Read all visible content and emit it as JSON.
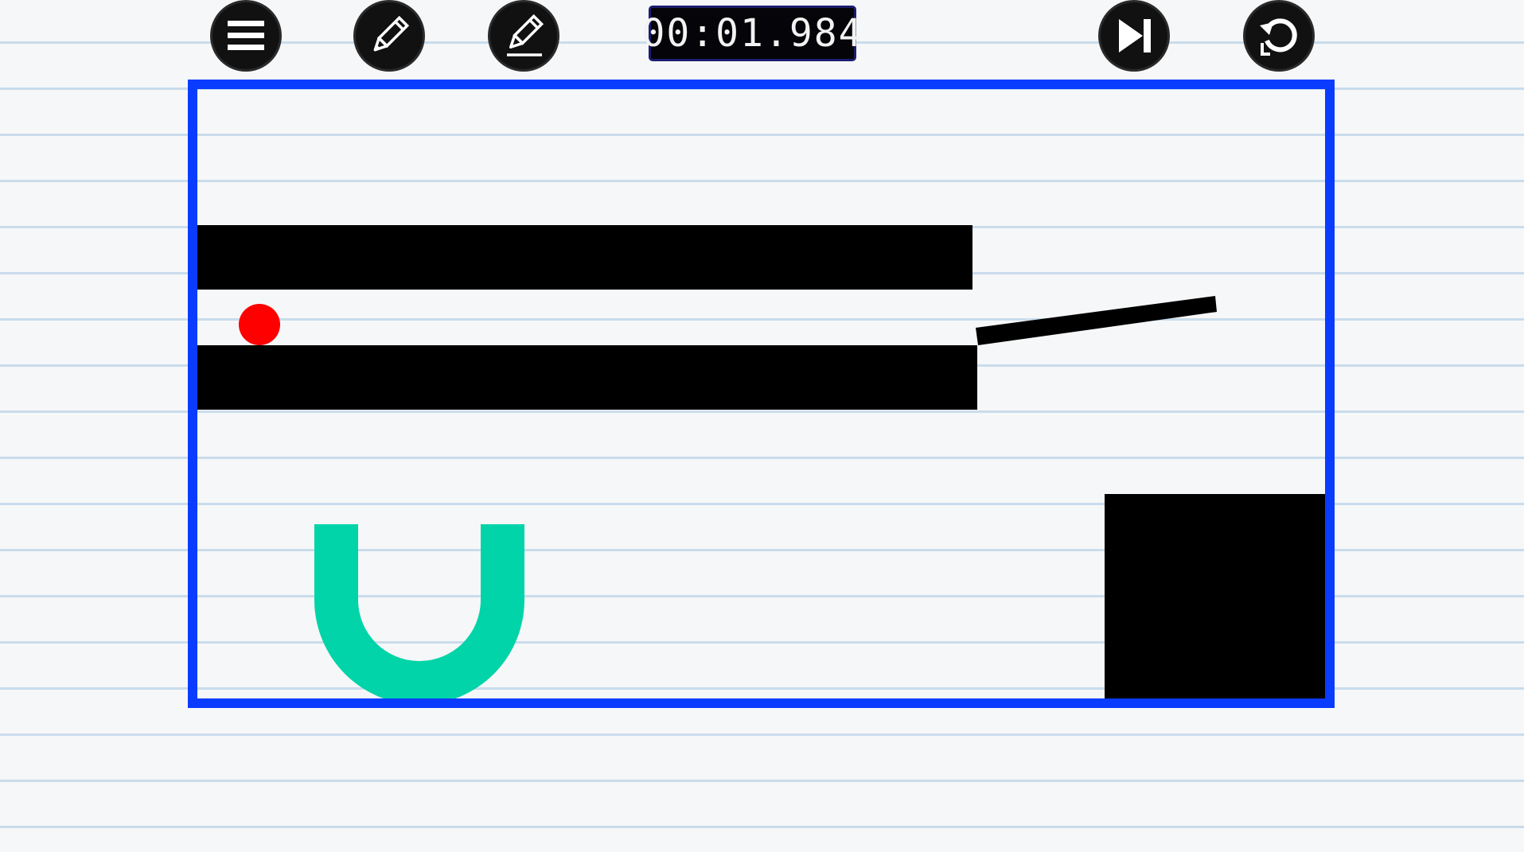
{
  "toolbar": {
    "menu_icon": "hamburger-menu-icon",
    "pencil_icon": "pencil-icon",
    "eraser_icon": "eraser-pencil-icon",
    "skip_icon": "skip-forward-icon",
    "restart_icon": "restart-icon"
  },
  "timer": {
    "value": "00:01.984"
  },
  "colors": {
    "frame": "#0a3cff",
    "wall": "#000000",
    "ball": "#ff0000",
    "cup": "#00d4a8",
    "paper_line": "#c9dcec"
  }
}
